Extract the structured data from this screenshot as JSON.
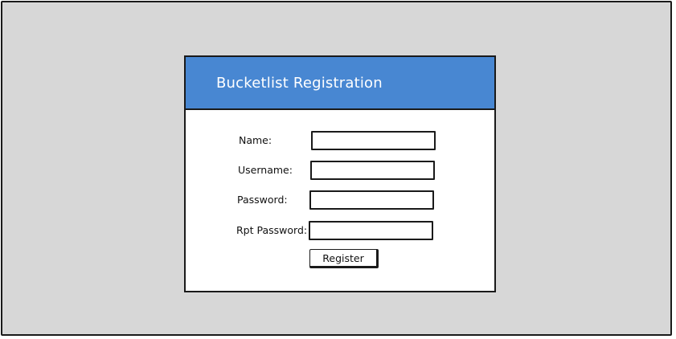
{
  "dialog": {
    "title": "Bucketlist Registration"
  },
  "form": {
    "fields": [
      {
        "label": "Name:",
        "value": "",
        "placeholder": ""
      },
      {
        "label": "Username:",
        "value": "",
        "placeholder": ""
      },
      {
        "label": "Password:",
        "value": "",
        "placeholder": ""
      },
      {
        "label": "Rpt Password:",
        "value": "",
        "placeholder": ""
      }
    ],
    "register_label": "Register"
  },
  "colors": {
    "header": "#4887d2",
    "background": "#d7d7d7",
    "border": "#1a1a1a"
  }
}
